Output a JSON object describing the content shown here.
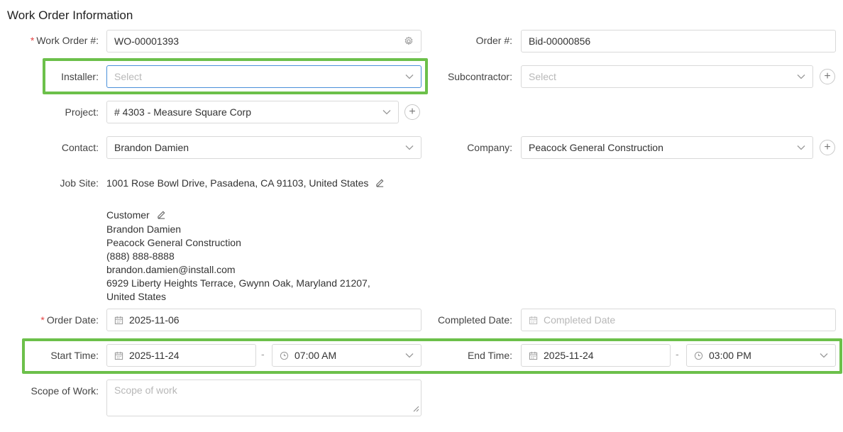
{
  "section_title": "Work Order Information",
  "work_order": {
    "label": "Work Order #:",
    "required": "*",
    "value": "WO-00001393",
    "icon": "gear-icon"
  },
  "order": {
    "label": "Order #:",
    "value": "Bid-00000856"
  },
  "installer": {
    "label": "Installer:",
    "placeholder": "Select"
  },
  "subcontractor": {
    "label": "Subcontractor:",
    "placeholder": "Select"
  },
  "project": {
    "label": "Project:",
    "value": "# 4303 - Measure Square Corp"
  },
  "contact": {
    "label": "Contact:",
    "value": "Brandon Damien"
  },
  "company": {
    "label": "Company:",
    "value": "Peacock General Construction"
  },
  "job_site": {
    "label": "Job Site:",
    "value": "1001 Rose Bowl Drive, Pasadena, CA 91103, United States"
  },
  "customer": {
    "heading": "Customer",
    "name": "Brandon Damien",
    "company": "Peacock General Construction",
    "phone": "(888) 888-8888",
    "email": "brandon.damien@install.com",
    "address_line1": "6929 Liberty Heights Terrace, Gwynn Oak, Maryland 21207,",
    "address_line2": "United States"
  },
  "order_date": {
    "label": "Order Date:",
    "required": "*",
    "value": "2025-11-06"
  },
  "completed_date": {
    "label": "Completed Date:",
    "placeholder": "Completed Date"
  },
  "start_time": {
    "label": "Start Time:",
    "date": "2025-11-24",
    "time": "07:00 AM",
    "separator": "-"
  },
  "end_time": {
    "label": "End Time:",
    "date": "2025-11-24",
    "time": "03:00 PM",
    "separator": "-"
  },
  "scope_of_work": {
    "label": "Scope of Work:",
    "placeholder": "Scope of work"
  },
  "colors": {
    "highlight": "#6cc04a",
    "required": "#e54545",
    "focus_border": "#4a90d9"
  }
}
